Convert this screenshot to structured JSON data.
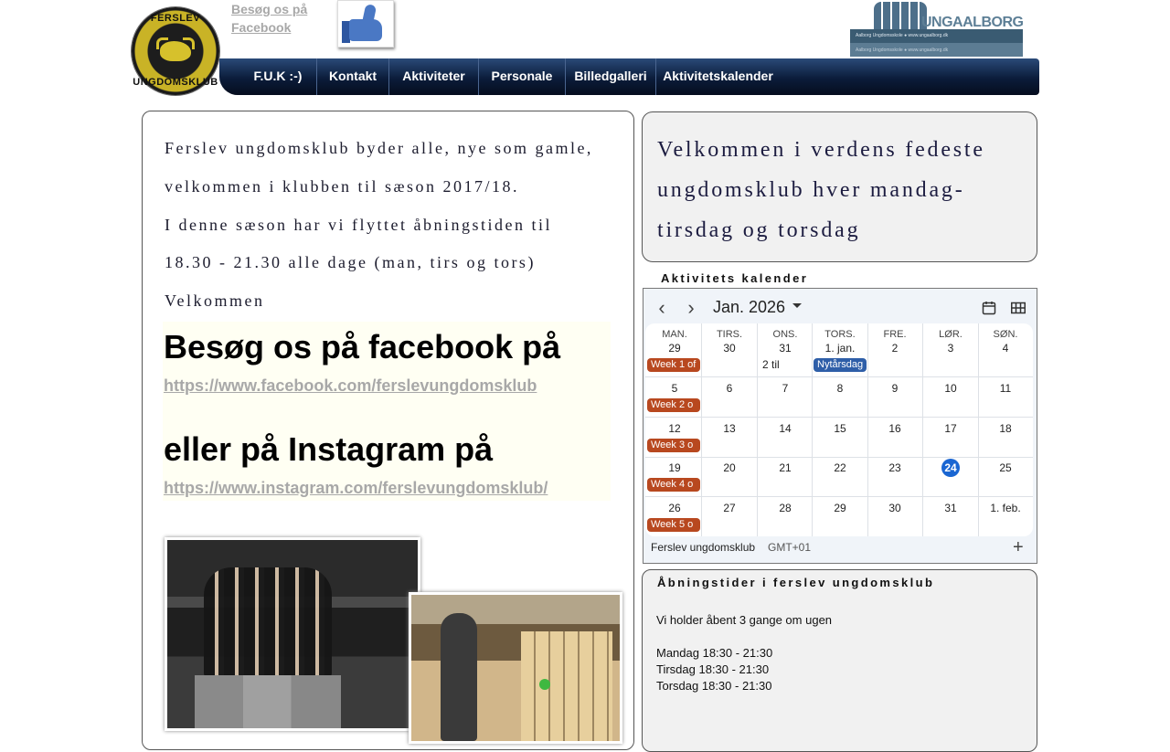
{
  "header": {
    "logo": {
      "text_top": "FERSLEV",
      "text_bottom": "UNGDOMSKLUB"
    },
    "facebook_link": "Besøg os på Facebook",
    "ungaalborg_banner": {
      "brand": "UNGAALBORG",
      "sub": "Aalborg Ungdomsskole   ●   www.ungaalborg.dk"
    }
  },
  "nav": {
    "items": [
      "F.U.K :-)",
      "Kontakt",
      "Aktiviteter",
      "Personale",
      "Billedgalleri",
      "Aktivitetskalender"
    ]
  },
  "intro": {
    "line1": "Ferslev ungdomsklub byder alle, nye som gamle,",
    "line2": "velkommen i klubben til sæson 2017/18.",
    "line3": "I denne sæson har vi flyttet åbningstiden til",
    "line4": "18.30 - 21.30 alle dage (man, tirs og tors)",
    "line5": "Velkommen"
  },
  "social": {
    "facebook_heading": "Besøg os på facebook på",
    "facebook_url": "https://www.facebook.com/ferslevungdomsklub",
    "instagram_heading": "eller på Instagram på",
    "instagram_url": "https://www.instagram.com/ferslevungdomsklub/"
  },
  "welcome": {
    "line1": "Velkommen i verdens fedeste",
    "line2": "ungdomsklub hver mandag-",
    "line3": "tirsdag og torsdag"
  },
  "calendar": {
    "label": "Aktivitets kalender",
    "month": "Jan. 2026",
    "weekdays": [
      "MAN.",
      "TIRS.",
      "ONS.",
      "TORS.",
      "FRE.",
      "LØR.",
      "SØN."
    ],
    "weeks": [
      [
        "29",
        "30",
        "31",
        "1. jan.",
        "2",
        "3",
        "4"
      ],
      [
        "5",
        "6",
        "7",
        "8",
        "9",
        "10",
        "11"
      ],
      [
        "12",
        "13",
        "14",
        "15",
        "16",
        "17",
        "18"
      ],
      [
        "19",
        "20",
        "21",
        "22",
        "23",
        "24",
        "25"
      ],
      [
        "26",
        "27",
        "28",
        "29",
        "30",
        "31",
        "1. feb."
      ]
    ],
    "week_events": [
      "Week 1 of",
      "Week 2 o",
      "Week 3 o",
      "Week 4 o",
      "Week 5 o"
    ],
    "other_events": {
      "wed_more": "2 til",
      "holiday": "Nytårsdag"
    },
    "today": "24",
    "footer_name": "Ferslev ungdomsklub",
    "footer_tz": "GMT+01",
    "add_symbol": "+",
    "colors": {
      "week_event": "#b8481f",
      "holiday_event": "#2e5ea8",
      "today": "#1a66d2"
    }
  },
  "hours": {
    "title": "Åbningstider i ferslev ungdomsklub",
    "intro": "Vi holder åbent 3 gange om ugen",
    "monday": "Mandag 18:30 - 21:30",
    "tuesday": "Tirsdag 18:30 - 21:30",
    "thursday": "Torsdag 18:30 - 21:30"
  }
}
